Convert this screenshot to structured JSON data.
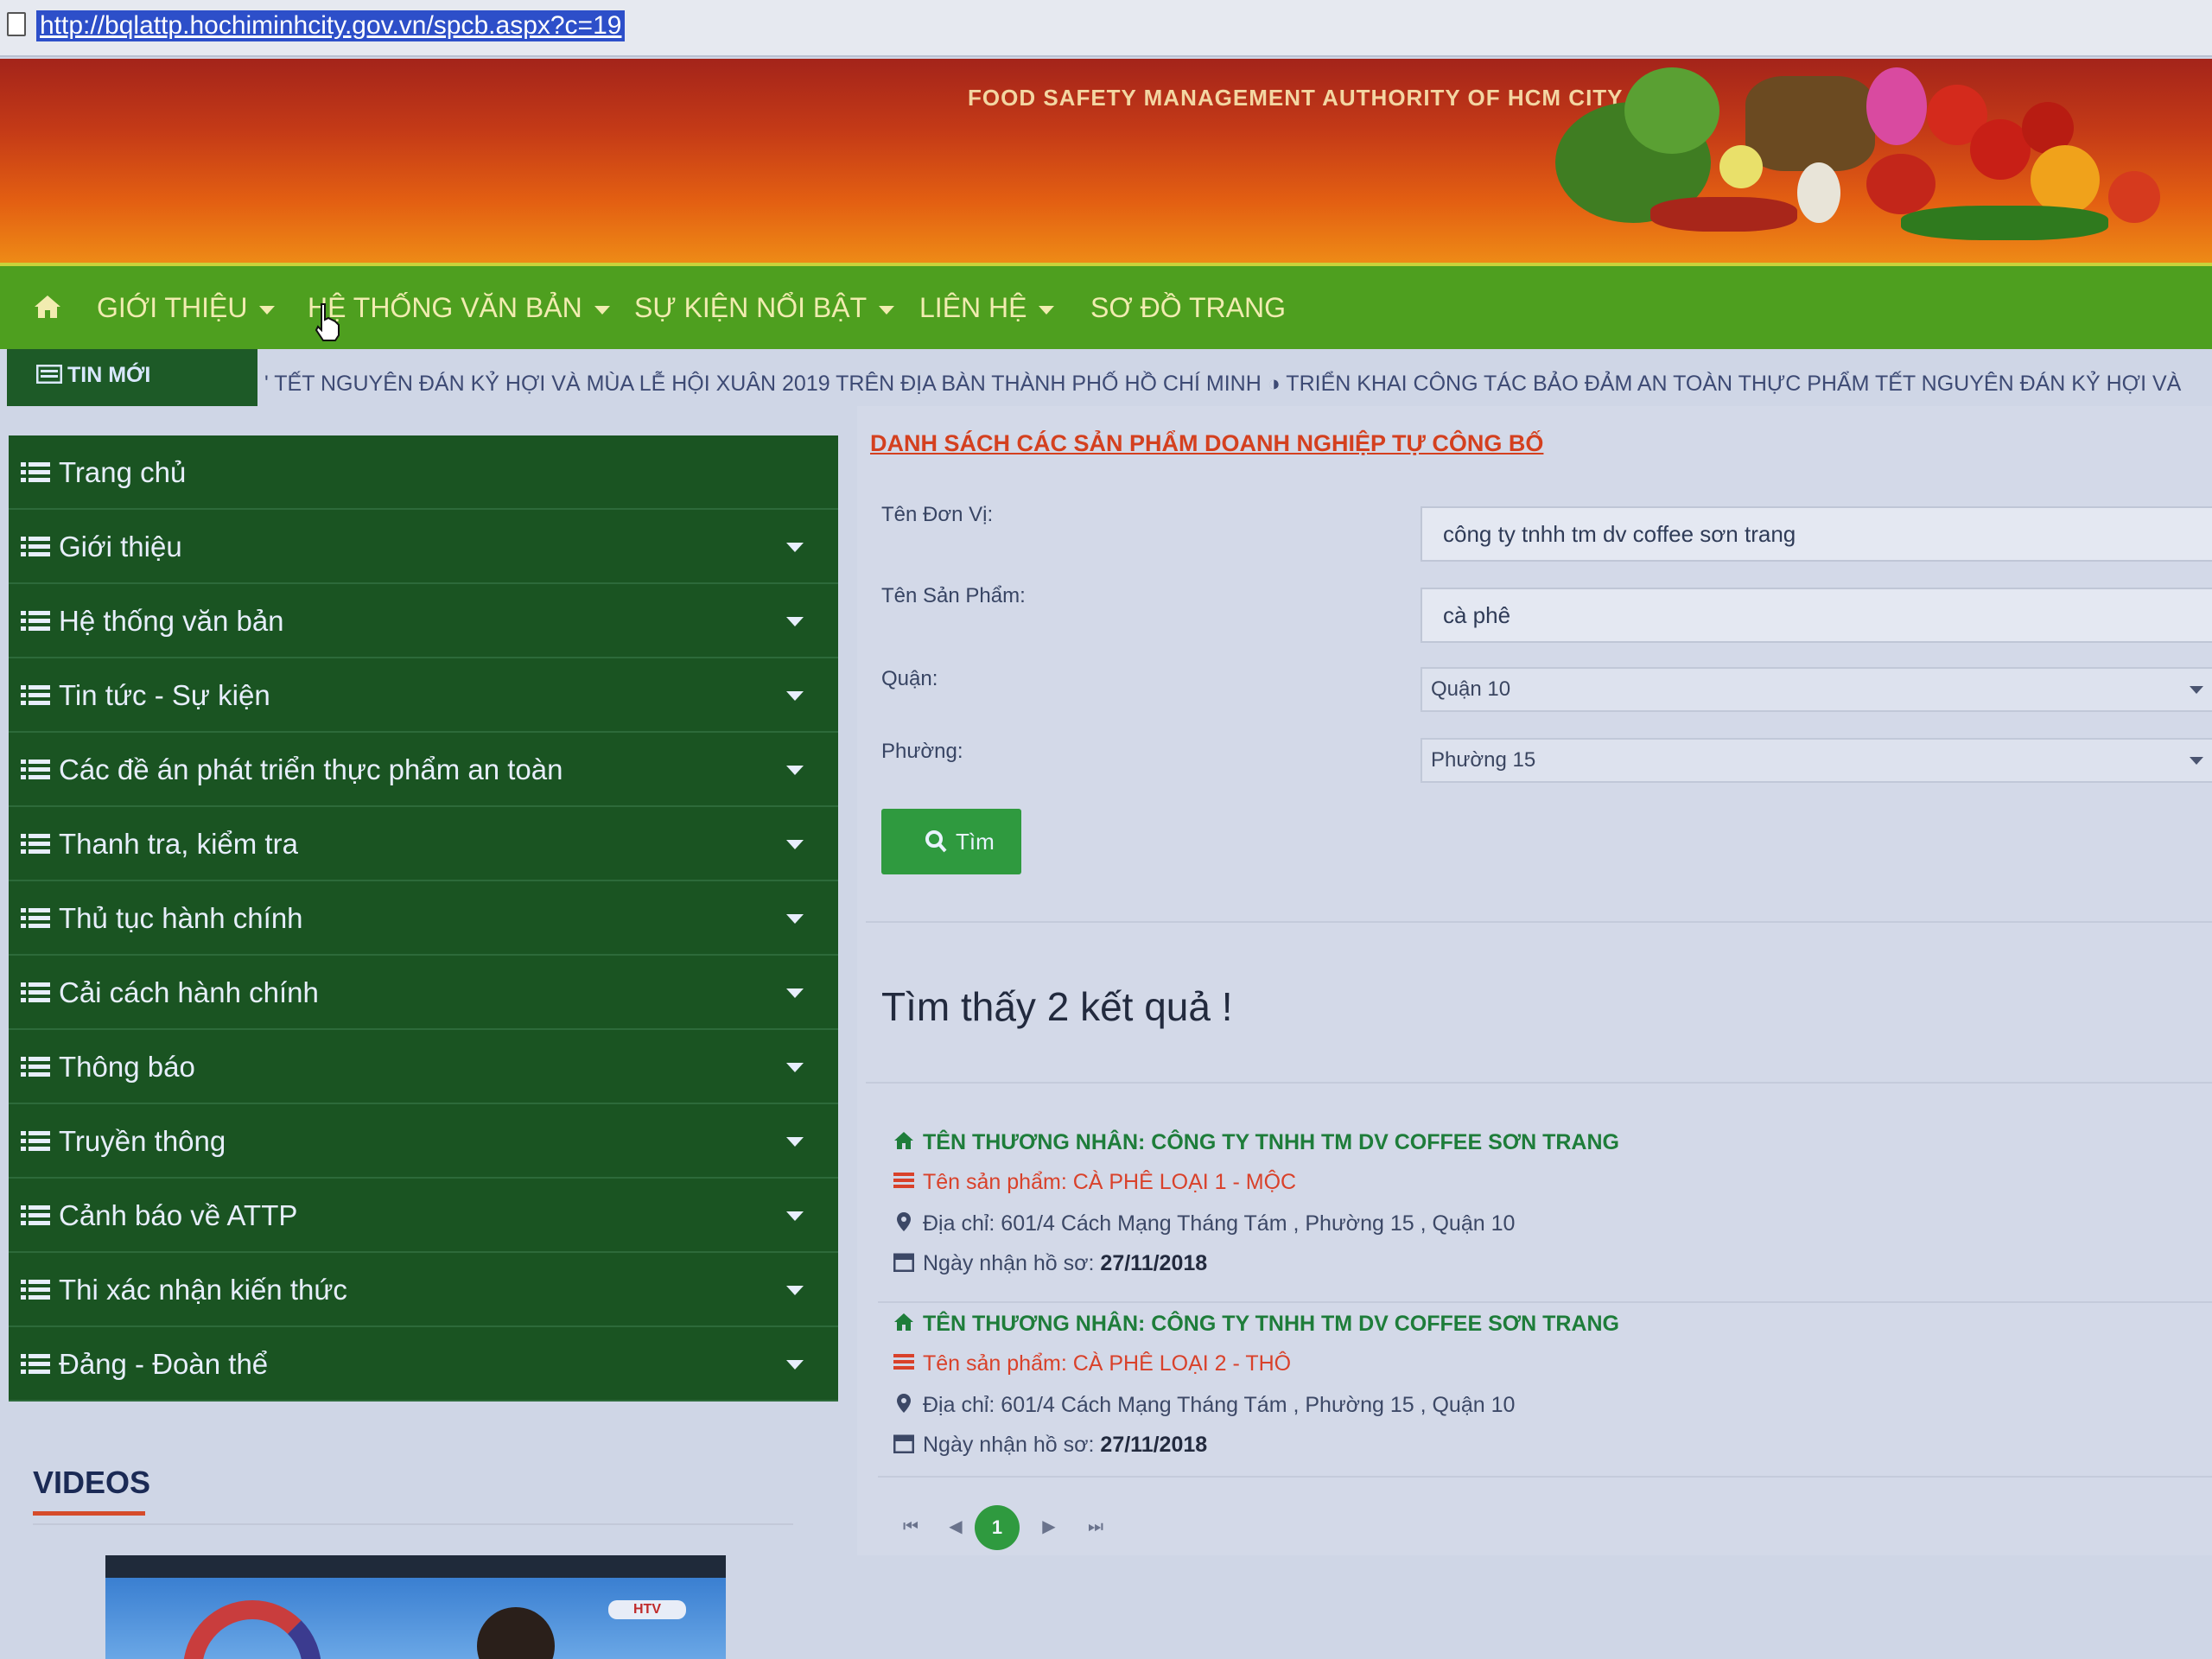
{
  "browser": {
    "url": "http://bqlattp.hochiminhcity.gov.vn/spcb.aspx?c=19"
  },
  "banner": {
    "title": "FOOD SAFETY MANAGEMENT AUTHORITY OF HCM CITY"
  },
  "nav": {
    "items": [
      {
        "label": "GIỚI THIỆU"
      },
      {
        "label": "HỆ THỐNG VĂN BẢN"
      },
      {
        "label": "SỰ KIỆN NỔI BẬT"
      },
      {
        "label": "LIÊN HỆ"
      },
      {
        "label": "SƠ ĐỒ TRANG"
      }
    ]
  },
  "ticker": {
    "label": "TIN MỚI",
    "text": "' TẾT NGUYÊN ĐÁN KỶ HỢI VÀ MÙA LỄ HỘI XUÂN 2019 TRÊN ĐỊA BÀN THÀNH PHỐ HỒ CHÍ MINH     ◑ TRIỂN KHAI CÔNG TÁC BẢO ĐẢM AN TOÀN THỰC PHẨM TẾT NGUYÊN ĐÁN KỶ HỢI VÀ"
  },
  "sidebar": {
    "items": [
      {
        "label": "Trang chủ"
      },
      {
        "label": "Giới thiệu"
      },
      {
        "label": "Hệ thống văn bản"
      },
      {
        "label": "Tin tức - Sự kiện"
      },
      {
        "label": "Các đề án phát triển thực phẩm an toàn"
      },
      {
        "label": "Thanh tra, kiểm tra"
      },
      {
        "label": "Thủ tục hành chính"
      },
      {
        "label": "Cải cách hành chính"
      },
      {
        "label": "Thông báo"
      },
      {
        "label": "Truyền thông"
      },
      {
        "label": "Cảnh báo về ATTP"
      },
      {
        "label": "Thi xác nhận kiến thức"
      },
      {
        "label": "Đảng - Đoàn thể"
      }
    ]
  },
  "videos": {
    "title": "VIDEOS",
    "thumb_logo": "HTV"
  },
  "main": {
    "title": "DANH SÁCH CÁC SẢN PHẨM DOANH NGHIỆP TỰ CÔNG BỐ",
    "form": {
      "unit_label": "Tên Đơn Vị:",
      "unit_value": "công ty tnhh tm dv coffee sơn trang",
      "product_label": "Tên Sản Phẩm:",
      "product_value": "cà phê",
      "district_label": "Quận:",
      "district_value": "Quận 10",
      "ward_label": "Phường:",
      "ward_value": "Phường 15",
      "search_button": "Tìm"
    },
    "result_count": "Tìm thấy 2 kết quả !",
    "results": [
      {
        "merchant": "TÊN THƯƠNG NHÂN: CÔNG TY TNHH TM DV COFFEE SƠN TRANG",
        "product": "Tên sản phẩm: CÀ PHÊ LOẠI 1 - MỘC",
        "address": "Địa chỉ: 601/4 Cách Mạng Tháng Tám , Phường 15 , Quận 10",
        "date_label": "Ngày nhận hồ sơ:",
        "date": "27/11/2018"
      },
      {
        "merchant": "TÊN THƯƠNG NHÂN: CÔNG TY TNHH TM DV COFFEE SƠN TRANG",
        "product": "Tên sản phẩm: CÀ PHÊ LOẠI 2 - THÔ",
        "address": "Địa chỉ: 601/4 Cách Mạng Tháng Tám , Phường 15 , Quận 10",
        "date_label": "Ngày nhận hồ sơ:",
        "date": "27/11/2018"
      }
    ],
    "pagination": {
      "current": "1",
      "first": "⏮",
      "prev": "◀",
      "next": "▶",
      "last": "⏭"
    }
  },
  "colors": {
    "nav_green": "#4e9f1f",
    "sidebar_green": "#1a5422",
    "accent_red": "#d4401f",
    "button_green": "#2f9a3f"
  }
}
